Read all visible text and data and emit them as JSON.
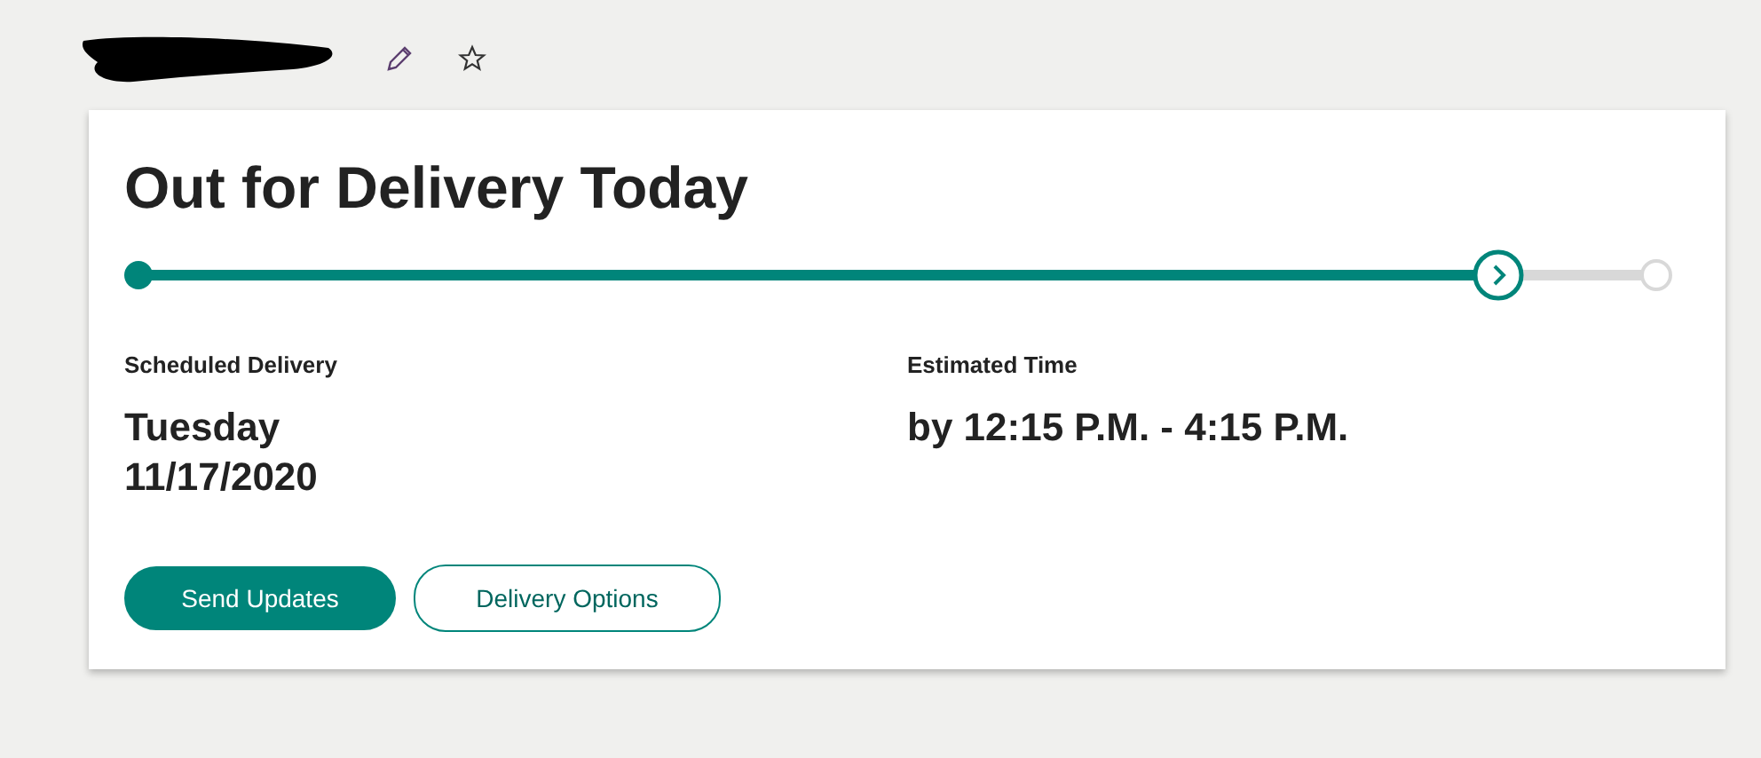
{
  "title": "Out for Delivery Today",
  "progress": {
    "level": 0.895
  },
  "details": [
    {
      "label": "Scheduled Delivery",
      "value": "Tuesday\n11/17/2020"
    },
    {
      "label": "Estimated Time",
      "value": "by 12:15 P.M. - 4:15 P.M."
    }
  ],
  "buttons": [
    {
      "label": "Send Updates",
      "kind": "primary"
    },
    {
      "label": "Delivery Options",
      "kind": "outline"
    }
  ]
}
